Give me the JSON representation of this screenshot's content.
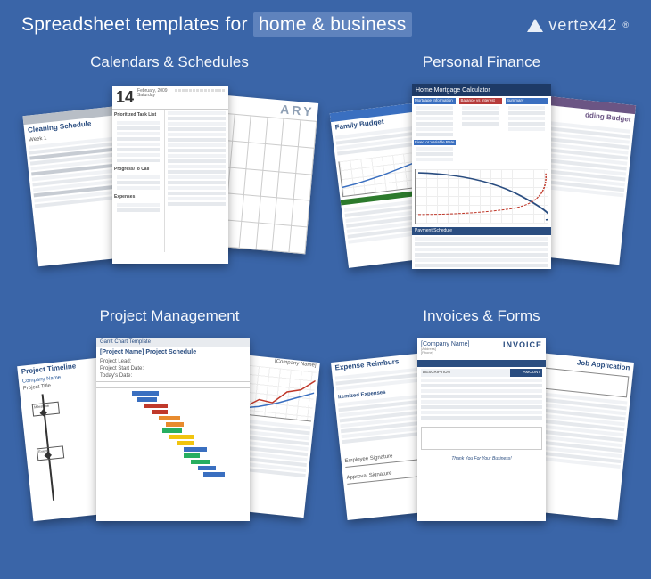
{
  "header": {
    "headline_pre": "Spreadsheet templates for",
    "headline_hl": "home & business",
    "logo_text": "vertex42"
  },
  "categories": {
    "calendars": {
      "title": "Calendars & Schedules"
    },
    "finance": {
      "title": "Personal Finance"
    },
    "project": {
      "title": "Project Management"
    },
    "invoices": {
      "title": "Invoices & Forms"
    }
  },
  "sheets": {
    "cleaning": {
      "title": "Cleaning Schedule",
      "sub": "Week 1"
    },
    "daily": {
      "date_num": "14",
      "date_text": "February, 2009",
      "day": "Saturday",
      "section1": "Prioritized Task List",
      "section2": "Progress/To Call",
      "section3": "Expenses"
    },
    "monthly": {
      "title": "ARY"
    },
    "family_budget": {
      "title": "Family Budget"
    },
    "mortgage": {
      "title": "Home Mortgage Calculator",
      "box1": "Mortgage Information",
      "box2": "Balance vs Interest",
      "box3": "Summary",
      "box4": "Fixed or Variable Rate",
      "footer": "Payment Schedule"
    },
    "wedding": {
      "title": "dding Budget"
    },
    "timeline": {
      "title": "Project Timeline",
      "company": "Company Name",
      "sub": "Project Title"
    },
    "gantt": {
      "title": "Gantt Chart Template",
      "sub": "[Project Name] Project Schedule",
      "company": "[Company Name]",
      "lead": "Project Lead:",
      "start": "Project Start Date:",
      "today": "Today's Date:"
    },
    "expense": {
      "title": "Expense Reimburs",
      "section": "Itemized Expenses",
      "sig1": "Employee Signature",
      "sig2": "Approval Signature"
    },
    "invoice": {
      "company": "[Company Name]",
      "word": "INVOICE",
      "thanks": "Thank You For Your Business!"
    },
    "jobapp": {
      "title": "Job Application"
    }
  }
}
